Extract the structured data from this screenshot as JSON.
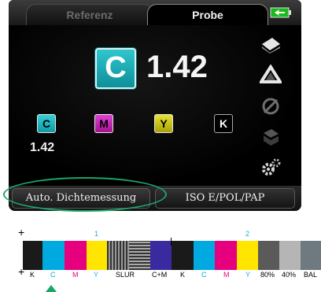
{
  "tabs": [
    {
      "label": "Referenz",
      "active": false
    },
    {
      "label": "Probe",
      "active": true
    }
  ],
  "status": {
    "battery_icon": "battery-charging-icon"
  },
  "measurement": {
    "primary_channel": "C",
    "primary_value": "1.42",
    "channels": [
      {
        "label": "C",
        "value": "1.42",
        "color": "#1fb5bf"
      },
      {
        "label": "M",
        "value": "",
        "color": "#c41fb3"
      },
      {
        "label": "Y",
        "value": "",
        "color": "#c9c21a"
      },
      {
        "label": "K",
        "value": "",
        "color": "#000000"
      }
    ]
  },
  "side_icons": [
    "pages-icon",
    "prism-icon",
    "no-filter-icon",
    "stack-icon",
    "gear-icon"
  ],
  "bottom": {
    "auto_button": "Auto. Dichtemessung",
    "iso_button": "ISO E/POL/PAP"
  },
  "strip": {
    "group_numbers": [
      "1",
      "2"
    ],
    "labels": [
      "K",
      "C",
      "M",
      "Y",
      "SLUR",
      "C+M",
      "K",
      "C",
      "M",
      "Y",
      "80%",
      "40%",
      "BAL"
    ],
    "colors": {
      "cyan": "#00a9e0",
      "magenta": "#e6007e",
      "yellow": "#ffe500",
      "black": "#1a1a1a",
      "blue": "#3a2aa0"
    }
  },
  "accent": "#1aa56a"
}
